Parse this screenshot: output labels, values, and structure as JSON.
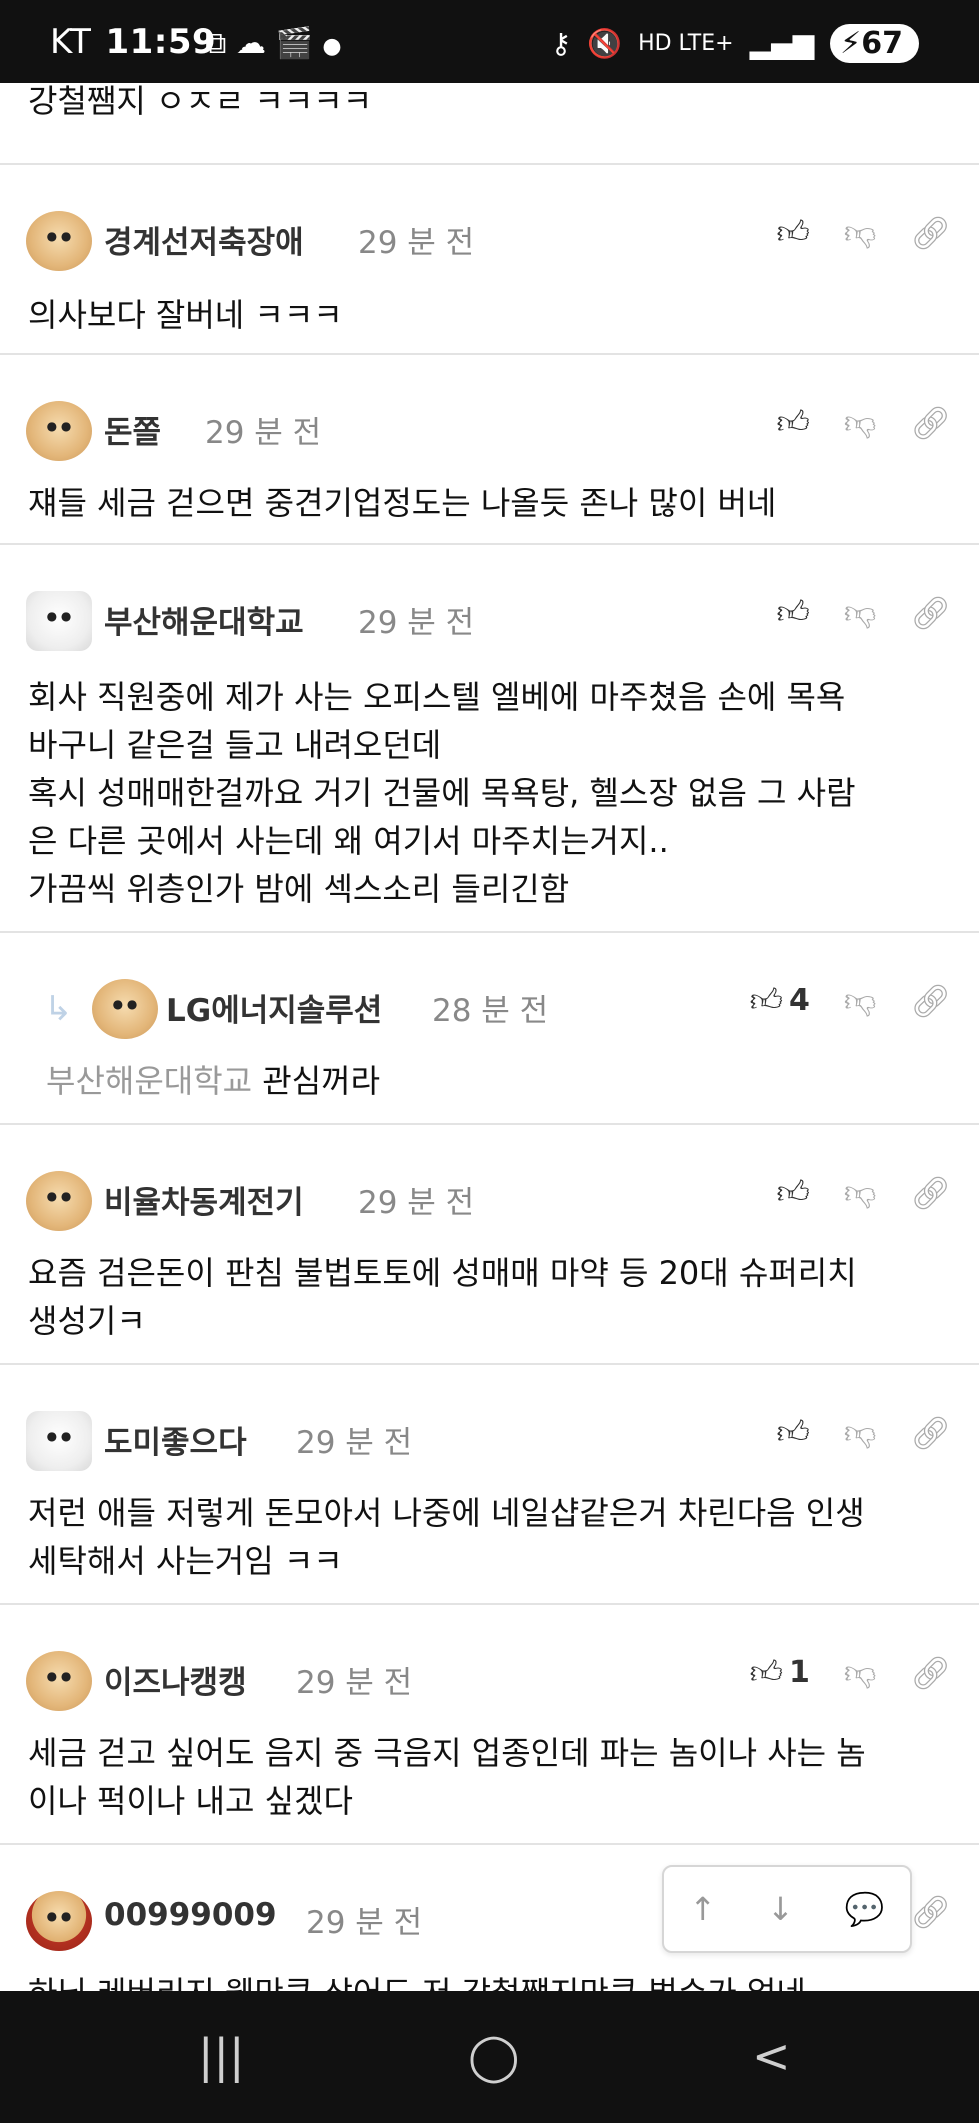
{
  "statusbar": {
    "carrier": "KT",
    "time": "11:59",
    "indicators": "HD LTE+",
    "battery": "67"
  },
  "top_fragment": "강철쨈지 ㅇㅈㄹ ㅋㅋㅋㅋ",
  "comments": [
    {
      "nick": "경계선저축장애",
      "time": "29 분 전",
      "text": "의사보다 잘버네 ㅋㅋㅋ",
      "likes": ""
    },
    {
      "nick": "돈쫄",
      "time": "29 분 전",
      "text": "쟤들 세금 걷으면 중견기업정도는 나올듯 존나 많이 버네",
      "likes": ""
    },
    {
      "nick": "부산해운대학교",
      "time": "29 분 전",
      "text": "회사 직원중에 제가 사는 오피스텔 엘베에 마주쳤음 손에 목욕\n바구니 같은걸 들고 내려오던데\n혹시 성매매한걸까요 거기 건물에 목욕탕, 헬스장 없음 그 사람\n은 다른 곳에서 사는데 왜 여기서 마주치는거지..\n가끔씩 위층인가 밤에 섹스소리 들리긴함",
      "likes": ""
    },
    {
      "nick": "LG에너지솔루션",
      "time": "28 분 전",
      "mention": "부산해운대학교",
      "text": "관심꺼라",
      "likes": "4"
    },
    {
      "nick": "비율차동계전기",
      "time": "29 분 전",
      "text": "요즘 검은돈이 판침 불법토토에 성매매 마약 등 20대 슈퍼리치\n생성기ㅋ",
      "likes": ""
    },
    {
      "nick": "도미좋으다",
      "time": "29 분 전",
      "text": "저런 애들 저렇게 돈모아서 나중에 네일샵같은거 차린다음 인생\n세탁해서 사는거임 ㅋㅋ",
      "likes": ""
    },
    {
      "nick": "이즈나캥캥",
      "time": "29 분 전",
      "text": "세금 걷고 싶어도 음지 중 극음지 업종인데 파는 놈이나 사는 놈\n이나 퍽이나 내고 싶겠다",
      "likes": "1"
    },
    {
      "nick": "00999009",
      "time": "29 분 전",
      "text": "하닉 레버리지 웬만큼 샀어도 저 강철쨈지만큼 벌수가 없네",
      "likes": ""
    }
  ],
  "icons": {
    "like": "thumbs-up-icon",
    "dislike": "thumbs-down-icon",
    "link": "link-icon"
  },
  "floatnav": {
    "up": "↑",
    "down": "↓",
    "comment": "💬"
  },
  "sysnav": {
    "recent": "|||",
    "home": "◯",
    "back": "<"
  }
}
